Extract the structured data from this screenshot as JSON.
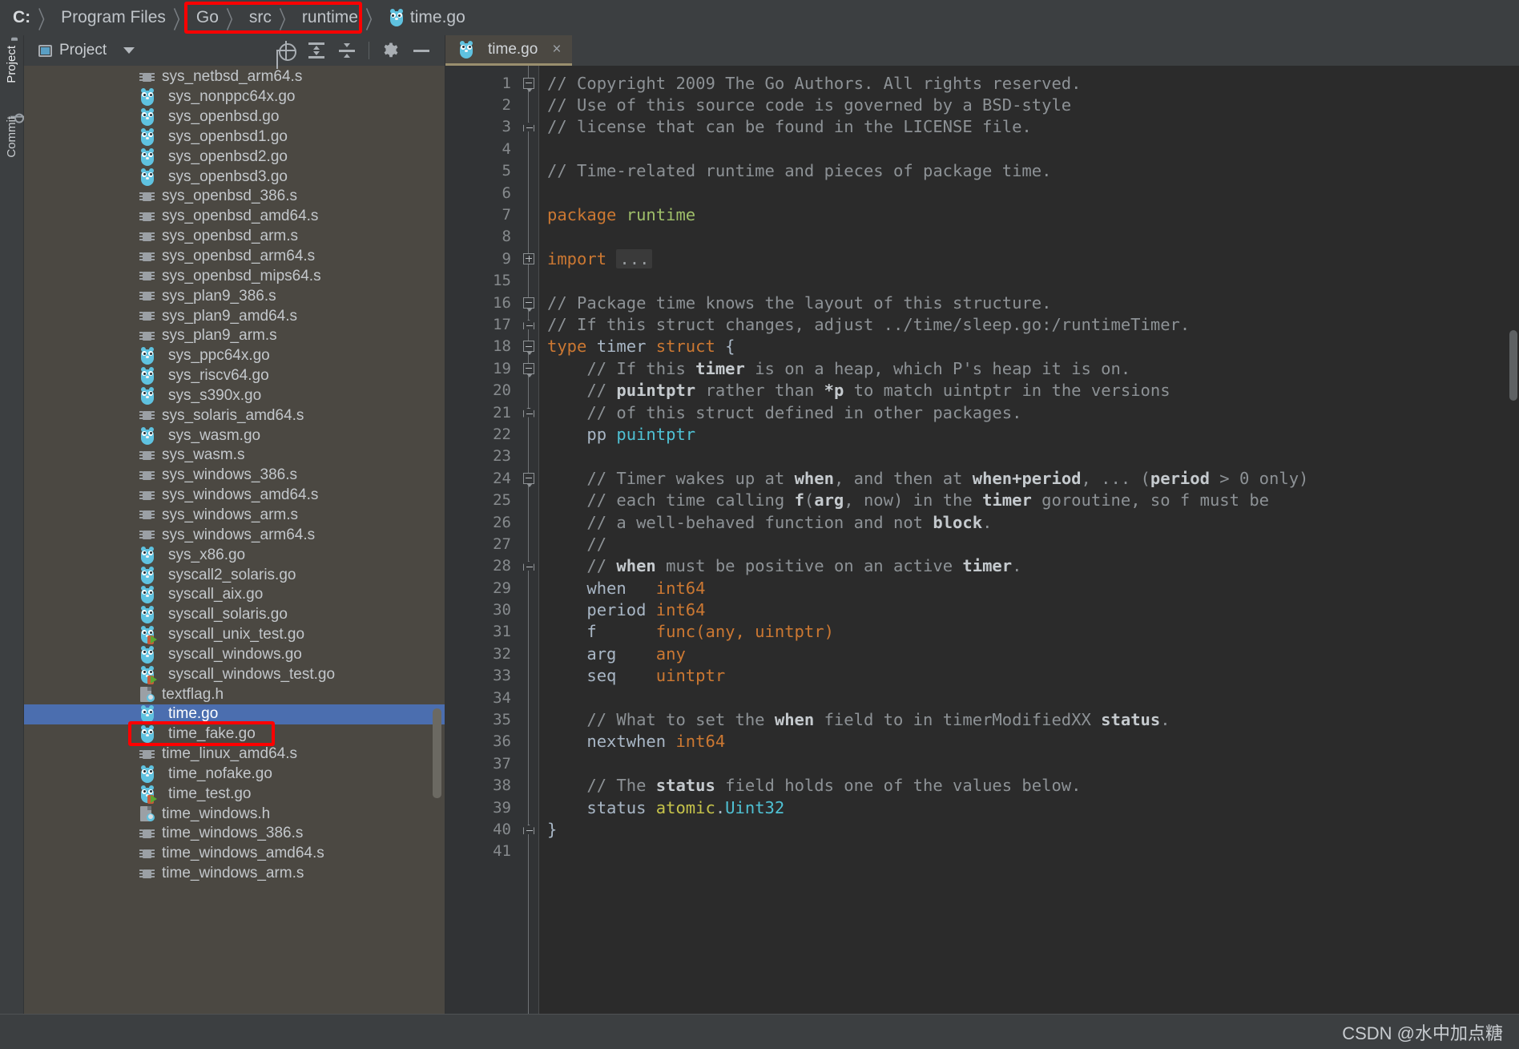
{
  "breadcrumb": {
    "items": [
      {
        "label": "C:",
        "bold": true,
        "icon": null
      },
      {
        "label": "Program Files",
        "bold": false,
        "icon": null
      },
      {
        "label": "Go",
        "bold": false,
        "icon": null
      },
      {
        "label": "src",
        "bold": false,
        "icon": null
      },
      {
        "label": "runtime",
        "bold": false,
        "icon": null
      },
      {
        "label": "time.go",
        "bold": false,
        "icon": "go-file-icon"
      }
    ],
    "separator": "〉",
    "highlight_color": "#ff0000"
  },
  "tool_strip": {
    "tabs": [
      {
        "label": "Project",
        "icon": "folder-icon",
        "active": true
      },
      {
        "label": "Commit",
        "icon": "commit-icon",
        "active": false
      }
    ]
  },
  "project_panel": {
    "title": "Project",
    "title_icon": "project-view-icon",
    "dropdown_icon": "chevron-down-icon",
    "toolbar_icons": [
      {
        "name": "locate-target-icon",
        "title": "Select Opened File"
      },
      {
        "name": "expand-all-icon",
        "title": "Expand All"
      },
      {
        "name": "collapse-all-icon",
        "title": "Collapse All"
      },
      {
        "name": "settings-gear-icon",
        "title": "Settings"
      },
      {
        "name": "hide-minimize-icon",
        "title": "Hide"
      }
    ],
    "files": [
      {
        "name": "sys_netbsd_arm64.s",
        "type": "asm"
      },
      {
        "name": "sys_nonppc64x.go",
        "type": "go"
      },
      {
        "name": "sys_openbsd.go",
        "type": "go"
      },
      {
        "name": "sys_openbsd1.go",
        "type": "go"
      },
      {
        "name": "sys_openbsd2.go",
        "type": "go"
      },
      {
        "name": "sys_openbsd3.go",
        "type": "go"
      },
      {
        "name": "sys_openbsd_386.s",
        "type": "asm"
      },
      {
        "name": "sys_openbsd_amd64.s",
        "type": "asm"
      },
      {
        "name": "sys_openbsd_arm.s",
        "type": "asm"
      },
      {
        "name": "sys_openbsd_arm64.s",
        "type": "asm"
      },
      {
        "name": "sys_openbsd_mips64.s",
        "type": "asm"
      },
      {
        "name": "sys_plan9_386.s",
        "type": "asm"
      },
      {
        "name": "sys_plan9_amd64.s",
        "type": "asm"
      },
      {
        "name": "sys_plan9_arm.s",
        "type": "asm"
      },
      {
        "name": "sys_ppc64x.go",
        "type": "go"
      },
      {
        "name": "sys_riscv64.go",
        "type": "go"
      },
      {
        "name": "sys_s390x.go",
        "type": "go"
      },
      {
        "name": "sys_solaris_amd64.s",
        "type": "asm"
      },
      {
        "name": "sys_wasm.go",
        "type": "go"
      },
      {
        "name": "sys_wasm.s",
        "type": "asm"
      },
      {
        "name": "sys_windows_386.s",
        "type": "asm"
      },
      {
        "name": "sys_windows_amd64.s",
        "type": "asm"
      },
      {
        "name": "sys_windows_arm.s",
        "type": "asm"
      },
      {
        "name": "sys_windows_arm64.s",
        "type": "asm"
      },
      {
        "name": "sys_x86.go",
        "type": "go"
      },
      {
        "name": "syscall2_solaris.go",
        "type": "go"
      },
      {
        "name": "syscall_aix.go",
        "type": "go"
      },
      {
        "name": "syscall_solaris.go",
        "type": "go"
      },
      {
        "name": "syscall_unix_test.go",
        "type": "go-test"
      },
      {
        "name": "syscall_windows.go",
        "type": "go"
      },
      {
        "name": "syscall_windows_test.go",
        "type": "go-test"
      },
      {
        "name": "textflag.h",
        "type": "header"
      },
      {
        "name": "time.go",
        "type": "go",
        "selected": true
      },
      {
        "name": "time_fake.go",
        "type": "go"
      },
      {
        "name": "time_linux_amd64.s",
        "type": "asm"
      },
      {
        "name": "time_nofake.go",
        "type": "go"
      },
      {
        "name": "time_test.go",
        "type": "go-test"
      },
      {
        "name": "time_windows.h",
        "type": "header"
      },
      {
        "name": "time_windows_386.s",
        "type": "asm"
      },
      {
        "name": "time_windows_amd64.s",
        "type": "asm"
      },
      {
        "name": "time_windows_arm.s",
        "type": "asm"
      }
    ]
  },
  "editor": {
    "tabs": [
      {
        "label": "time.go",
        "icon": "go-file-icon",
        "close_icon": "×",
        "active": true
      }
    ],
    "line_numbers": [
      1,
      2,
      3,
      4,
      5,
      6,
      7,
      8,
      9,
      15,
      16,
      17,
      18,
      19,
      20,
      21,
      22,
      23,
      24,
      25,
      26,
      27,
      28,
      29,
      30,
      31,
      32,
      33,
      34,
      35,
      36,
      37,
      38,
      39,
      40,
      41
    ],
    "fold_markers": {
      "1": "minus-tip",
      "3": "end",
      "9": "plus",
      "16": "minus-tip",
      "17": "end",
      "18": "minus-tip",
      "19": "minus-tip",
      "21": "end",
      "24": "minus-tip",
      "28": "end",
      "40": "end"
    },
    "lines": [
      {
        "n": 1,
        "tokens": [
          {
            "t": "// Copyright 2009 The Go Authors. All rights reserved.",
            "c": "c-com"
          }
        ]
      },
      {
        "n": 2,
        "tokens": [
          {
            "t": "// Use of this source code is governed by a BSD-style",
            "c": "c-com"
          }
        ]
      },
      {
        "n": 3,
        "tokens": [
          {
            "t": "// license that can be found in the LICENSE file.",
            "c": "c-com"
          }
        ]
      },
      {
        "n": 4,
        "tokens": []
      },
      {
        "n": 5,
        "tokens": [
          {
            "t": "// Time-related runtime and pieces of package time.",
            "c": "c-com"
          }
        ]
      },
      {
        "n": 6,
        "tokens": []
      },
      {
        "n": 7,
        "tokens": [
          {
            "t": "package ",
            "c": "c-kw"
          },
          {
            "t": "runtime",
            "c": "c-pkg"
          }
        ]
      },
      {
        "n": 8,
        "tokens": []
      },
      {
        "n": 9,
        "tokens": [
          {
            "t": "import ",
            "c": "c-kw"
          },
          {
            "t": "...",
            "c": "fold-ph"
          }
        ]
      },
      {
        "n": 15,
        "tokens": []
      },
      {
        "n": 16,
        "tokens": [
          {
            "t": "// Package time knows the layout of this structure.",
            "c": "c-com"
          }
        ]
      },
      {
        "n": 17,
        "tokens": [
          {
            "t": "// If this struct changes, adjust ../time/sleep.go:/runtimeTimer.",
            "c": "c-com"
          }
        ]
      },
      {
        "n": 18,
        "tokens": [
          {
            "t": "type ",
            "c": "c-kw"
          },
          {
            "t": "timer ",
            "c": "c-id"
          },
          {
            "t": "struct",
            "c": "c-kw"
          },
          {
            "t": " {",
            "c": "c-punc"
          }
        ]
      },
      {
        "n": 19,
        "tokens": [
          {
            "t": "    // If this ",
            "c": "c-com"
          },
          {
            "t": "timer",
            "c": "c-comb"
          },
          {
            "t": " is on a heap, which P's heap it is on.",
            "c": "c-com"
          }
        ]
      },
      {
        "n": 20,
        "tokens": [
          {
            "t": "    // ",
            "c": "c-com"
          },
          {
            "t": "puintptr",
            "c": "c-comb"
          },
          {
            "t": " rather than ",
            "c": "c-com"
          },
          {
            "t": "*p",
            "c": "c-comb"
          },
          {
            "t": " to match uintptr in the versions",
            "c": "c-com"
          }
        ]
      },
      {
        "n": 21,
        "tokens": [
          {
            "t": "    // of this struct defined in other packages.",
            "c": "c-com"
          }
        ]
      },
      {
        "n": 22,
        "tokens": [
          {
            "t": "    pp ",
            "c": "c-id"
          },
          {
            "t": "puintptr",
            "c": "c-cyan"
          }
        ]
      },
      {
        "n": 23,
        "tokens": []
      },
      {
        "n": 24,
        "tokens": [
          {
            "t": "    // Timer wakes up at ",
            "c": "c-com"
          },
          {
            "t": "when",
            "c": "c-comb"
          },
          {
            "t": ", and then at ",
            "c": "c-com"
          },
          {
            "t": "when+period",
            "c": "c-comb"
          },
          {
            "t": ", ... (",
            "c": "c-com"
          },
          {
            "t": "period",
            "c": "c-comb"
          },
          {
            "t": " > 0 only)",
            "c": "c-com"
          }
        ]
      },
      {
        "n": 25,
        "tokens": [
          {
            "t": "    // each time calling ",
            "c": "c-com"
          },
          {
            "t": "f",
            "c": "c-comb"
          },
          {
            "t": "(",
            "c": "c-com"
          },
          {
            "t": "arg",
            "c": "c-comb"
          },
          {
            "t": ", now) in the ",
            "c": "c-com"
          },
          {
            "t": "timer",
            "c": "c-comb"
          },
          {
            "t": " goroutine, so f must be",
            "c": "c-com"
          }
        ]
      },
      {
        "n": 26,
        "tokens": [
          {
            "t": "    // a well-behaved function and not ",
            "c": "c-com"
          },
          {
            "t": "block",
            "c": "c-comb"
          },
          {
            "t": ".",
            "c": "c-com"
          }
        ]
      },
      {
        "n": 27,
        "tokens": [
          {
            "t": "    //",
            "c": "c-com"
          }
        ]
      },
      {
        "n": 28,
        "tokens": [
          {
            "t": "    // ",
            "c": "c-com"
          },
          {
            "t": "when",
            "c": "c-comb"
          },
          {
            "t": " must be positive on an active ",
            "c": "c-com"
          },
          {
            "t": "timer",
            "c": "c-comb"
          },
          {
            "t": ".",
            "c": "c-com"
          }
        ]
      },
      {
        "n": 29,
        "tokens": [
          {
            "t": "    when   ",
            "c": "c-id"
          },
          {
            "t": "int64",
            "c": "c-type"
          }
        ]
      },
      {
        "n": 30,
        "tokens": [
          {
            "t": "    period ",
            "c": "c-id"
          },
          {
            "t": "int64",
            "c": "c-type"
          }
        ]
      },
      {
        "n": 31,
        "tokens": [
          {
            "t": "    f      ",
            "c": "c-id"
          },
          {
            "t": "func(any, uintptr)",
            "c": "c-type"
          }
        ]
      },
      {
        "n": 32,
        "tokens": [
          {
            "t": "    arg    ",
            "c": "c-id"
          },
          {
            "t": "any",
            "c": "c-type"
          }
        ]
      },
      {
        "n": 33,
        "tokens": [
          {
            "t": "    seq    ",
            "c": "c-id"
          },
          {
            "t": "uintptr",
            "c": "c-type"
          }
        ]
      },
      {
        "n": 34,
        "tokens": []
      },
      {
        "n": 35,
        "tokens": [
          {
            "t": "    // What to set the ",
            "c": "c-com"
          },
          {
            "t": "when",
            "c": "c-comb"
          },
          {
            "t": " field to in timerModifiedXX ",
            "c": "c-com"
          },
          {
            "t": "status",
            "c": "c-comb"
          },
          {
            "t": ".",
            "c": "c-com"
          }
        ]
      },
      {
        "n": 36,
        "tokens": [
          {
            "t": "    nextwhen ",
            "c": "c-id"
          },
          {
            "t": "int64",
            "c": "c-type"
          }
        ]
      },
      {
        "n": 37,
        "tokens": []
      },
      {
        "n": 38,
        "tokens": [
          {
            "t": "    // The ",
            "c": "c-com"
          },
          {
            "t": "status",
            "c": "c-comb"
          },
          {
            "t": " field holds one of the values below.",
            "c": "c-com"
          }
        ]
      },
      {
        "n": 39,
        "tokens": [
          {
            "t": "    status ",
            "c": "c-id"
          },
          {
            "t": "atomic",
            "c": "c-yel"
          },
          {
            "t": ".",
            "c": "c-punc"
          },
          {
            "t": "Uint32",
            "c": "c-cyan"
          }
        ]
      },
      {
        "n": 40,
        "tokens": [
          {
            "t": "}",
            "c": "c-punc"
          }
        ]
      },
      {
        "n": 41,
        "tokens": []
      }
    ]
  },
  "footer": {
    "watermark": "CSDN @水中加点糖"
  }
}
